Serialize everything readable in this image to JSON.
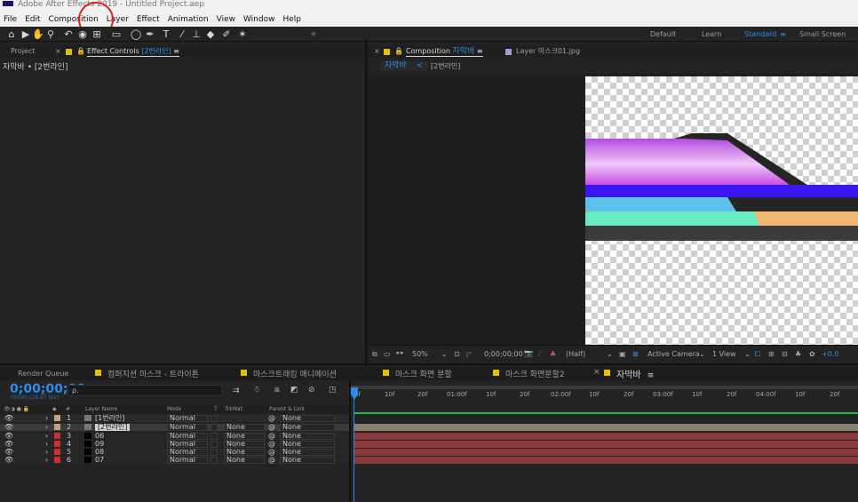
{
  "title_bar": {
    "text": "Adobe After Effects 2019 - Untitled Project.aep"
  },
  "menu": [
    "File",
    "Edit",
    "Composition",
    "Layer",
    "Effect",
    "Animation",
    "View",
    "Window",
    "Help"
  ],
  "workspaces": {
    "default": "Default",
    "learn": "Learn",
    "standard": "Standard",
    "standard_menu": "≡",
    "small_screen": "Small Screen"
  },
  "left_panel": {
    "tab_project": "Project",
    "tab_close": "×",
    "tab_effect_controls": "Effect Controls",
    "effect_layer": "[2번라인]",
    "tab_menu": "≡",
    "breadcrumb": "자막바 • [2번라인]"
  },
  "comp_panel": {
    "tab_close": "×",
    "tab_comp_label": "Composition",
    "tab_comp_name": "자막바",
    "tab_menu": "≡",
    "tab_layer": "Layer 마스크01.jpg",
    "flow_current": "자막바",
    "flow_arrow": "<",
    "flow_prev": "[2번라인]"
  },
  "viewer_footer": {
    "zoom": "50%",
    "timecode": "0;00;00;00",
    "resolution": "(Half)",
    "camera": "Active Camera",
    "view": "1 View",
    "exposure": "+0.0"
  },
  "timeline_tabs": [
    "Render Queue",
    "컴퍼지션 마스크 - 트라이톤",
    "마스크트래킹 애니메이션",
    "마스크 화면 분할",
    "마스크 화면분할2",
    "자막바"
  ],
  "timeline_tab_close": "×",
  "timeline_tab_menu": "≡",
  "timeline": {
    "timecode": "0;00;00;00",
    "frame_info": "00000 (29.97 fps)",
    "search_icon_glyph": "ρ.",
    "col_hash": "#",
    "col_layer_name": "Layer Name",
    "col_mode": "Mode",
    "col_t": "T",
    "col_trkmat": "TrkMat",
    "col_parent": "Parent & Link",
    "ruler": [
      "0f",
      "10f",
      "20f",
      "01:00f",
      "10f",
      "20f",
      "02:00f",
      "10f",
      "20f",
      "03:00f",
      "10f",
      "20f",
      "04:00f",
      "10f",
      "20f"
    ],
    "layers": [
      {
        "num": "1",
        "name": "[1번라인]",
        "mode": "Normal",
        "trkmat": "",
        "parent": "None",
        "color": "#c8a27c"
      },
      {
        "num": "2",
        "name": "[2번라인]",
        "mode": "Normal",
        "trkmat": "None",
        "parent": "None",
        "color": "#c8a27c"
      },
      {
        "num": "3",
        "name": "06",
        "mode": "Normal",
        "trkmat": "None",
        "parent": "None",
        "color": "#d02e2e"
      },
      {
        "num": "4",
        "name": "09",
        "mode": "Normal",
        "trkmat": "None",
        "parent": "None",
        "color": "#d02e2e"
      },
      {
        "num": "5",
        "name": "08",
        "mode": "Normal",
        "trkmat": "None",
        "parent": "None",
        "color": "#d02e2e"
      },
      {
        "num": "6",
        "name": "07",
        "mode": "Normal",
        "trkmat": "None",
        "parent": "None",
        "color": "#d02e2e"
      }
    ]
  },
  "colors": {
    "accent": "#2d8ceb",
    "annotation": "#e0201a",
    "layer_bar_red": "#8a3a3a",
    "layer_bar_tan": "#8b8070"
  }
}
